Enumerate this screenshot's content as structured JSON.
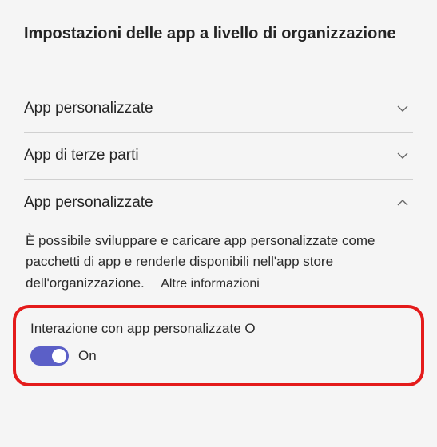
{
  "title": "Impostazioni delle app a livello di organizzazione",
  "sections": [
    {
      "title": "App personalizzate",
      "expanded": false
    },
    {
      "title": "App di terze parti",
      "expanded": false
    },
    {
      "title": "App personalizzate",
      "expanded": true,
      "description": "È possibile sviluppare e caricare app personalizzate come pacchetti di app e renderle disponibili nell'app store dell'organizzazione.",
      "learn_more": "Altre informazioni",
      "toggle": {
        "label": "Interazione con app personalizzate O",
        "state": "On",
        "on": true
      }
    }
  ]
}
